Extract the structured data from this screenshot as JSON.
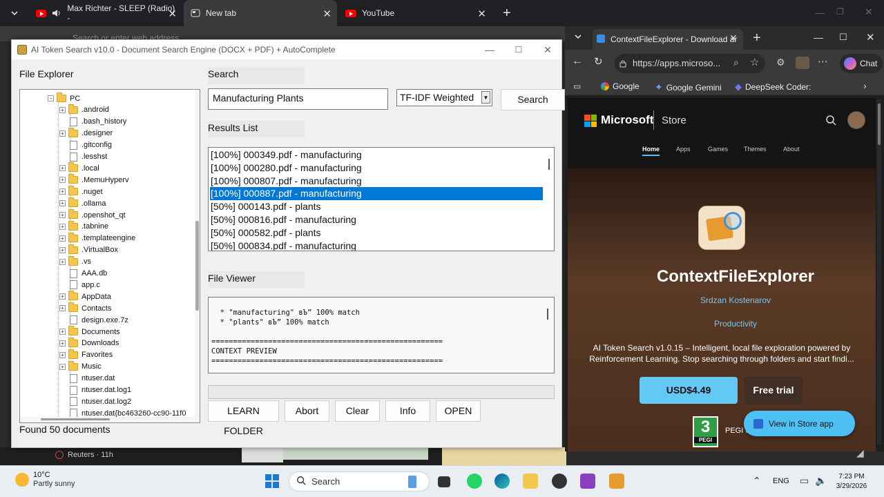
{
  "browser_tabs": [
    {
      "title": "Max Richter - SLEEP (Radio) -",
      "icon": "youtube-icon"
    },
    {
      "title": "New tab",
      "icon": "newtab-icon"
    },
    {
      "title": "YouTube",
      "icon": "youtube-icon"
    }
  ],
  "bg_browser": {
    "address_placeholder": "Search or enter web address",
    "news_item": "Reuters · 11h"
  },
  "app": {
    "title": "AI Token Search v10.0 - Document Search Engine (DOCX + PDF) + AutoComplete",
    "file_explorer_label": "File Explorer",
    "search_label": "Search",
    "results_label": "Results List",
    "viewer_label": "File Viewer",
    "search_value": "Manufacturing Plants",
    "method_value": "TF-IDF Weighted",
    "search_button": "Search",
    "status": "Found 50 documents",
    "tree": [
      {
        "label": "PC",
        "type": "folder",
        "expanded": true,
        "level": 0
      },
      {
        "label": ".android",
        "type": "folder",
        "level": 1
      },
      {
        "label": ".bash_history",
        "type": "file",
        "level": 1
      },
      {
        "label": ".designer",
        "type": "folder",
        "level": 1
      },
      {
        "label": ".gitconfig",
        "type": "file",
        "level": 1
      },
      {
        "label": ".lesshst",
        "type": "file",
        "level": 1
      },
      {
        "label": ".local",
        "type": "folder",
        "level": 1
      },
      {
        "label": ".MemuHyperv",
        "type": "folder",
        "level": 1
      },
      {
        "label": ".nuget",
        "type": "folder",
        "level": 1
      },
      {
        "label": ".ollama",
        "type": "folder",
        "level": 1
      },
      {
        "label": ".openshot_qt",
        "type": "folder",
        "level": 1
      },
      {
        "label": ".tabnine",
        "type": "folder",
        "level": 1
      },
      {
        "label": ".templateengine",
        "type": "folder",
        "level": 1
      },
      {
        "label": ".VirtualBox",
        "type": "folder",
        "level": 1
      },
      {
        "label": ".vs",
        "type": "folder",
        "level": 1
      },
      {
        "label": "AAA.db",
        "type": "file",
        "level": 1
      },
      {
        "label": "app.c",
        "type": "file",
        "level": 1
      },
      {
        "label": "AppData",
        "type": "folder",
        "level": 1
      },
      {
        "label": "Contacts",
        "type": "folder",
        "level": 1
      },
      {
        "label": "design.exe.7z",
        "type": "file",
        "level": 1
      },
      {
        "label": "Documents",
        "type": "folder",
        "level": 1
      },
      {
        "label": "Downloads",
        "type": "folder",
        "level": 1
      },
      {
        "label": "Favorites",
        "type": "folder",
        "level": 1
      },
      {
        "label": "Music",
        "type": "folder",
        "level": 1
      },
      {
        "label": "ntuser.dat",
        "type": "file",
        "level": 1
      },
      {
        "label": "ntuser.dat.log1",
        "type": "file",
        "level": 1
      },
      {
        "label": "ntuser.dat.log2",
        "type": "file",
        "level": 1
      },
      {
        "label": "ntuser.dat{bc463260-cc90-11f0",
        "type": "file",
        "level": 1
      }
    ],
    "results": [
      "[100%] 000349.pdf - manufacturing",
      "[100%] 000280.pdf - manufacturing",
      "[100%] 000807.pdf - manufacturing",
      "[100%] 000887.pdf - manufacturing",
      "[50%] 000143.pdf - plants",
      "[50%] 000816.pdf - manufacturing",
      "[50%] 000582.pdf - plants",
      "[50%] 000834.pdf - manufacturing"
    ],
    "selected_result": 3,
    "viewer_lines": [
      "  * \"manufacturing\" вЪ” 100% match",
      "  * \"plants\" вЪ” 100% match",
      "",
      "=====================================================",
      "CONTEXT PREVIEW",
      "====================================================="
    ],
    "buttons": [
      "LEARN FOLDER",
      "Abort",
      "Clear",
      "Info",
      "OPEN"
    ]
  },
  "edge": {
    "tab_title": "ContextFileExplorer - Download ar",
    "url": "https://apps.microso...",
    "chat_label": "Chat",
    "favorites": [
      "Google",
      "Google Gemini",
      "DeepSeek Coder:"
    ],
    "store": {
      "brand": "Microsoft",
      "store_label": "Store",
      "nav": [
        "Home",
        "Apps",
        "Games",
        "Themes",
        "About"
      ],
      "app_name": "ContextFileExplorer",
      "developer": "Srdzan Kostenarov",
      "category": "Productivity",
      "description": "AI Token Search v1.0.15 – Intelligent, local file exploration powered by Reinforcement Learning. Stop searching through folders and start findi...",
      "price": "USD$4.49",
      "trial": "Free trial",
      "pegi_number": "3",
      "pegi_label": "PEGI",
      "pegi_text": "PEGI 3",
      "view_in_store": "View in Store app"
    }
  },
  "taskbar": {
    "weather_temp": "10°C",
    "weather_desc": "Partly sunny",
    "search_placeholder": "Search",
    "language": "ENG",
    "time": "7:23 PM",
    "date": "3/29/2026"
  }
}
